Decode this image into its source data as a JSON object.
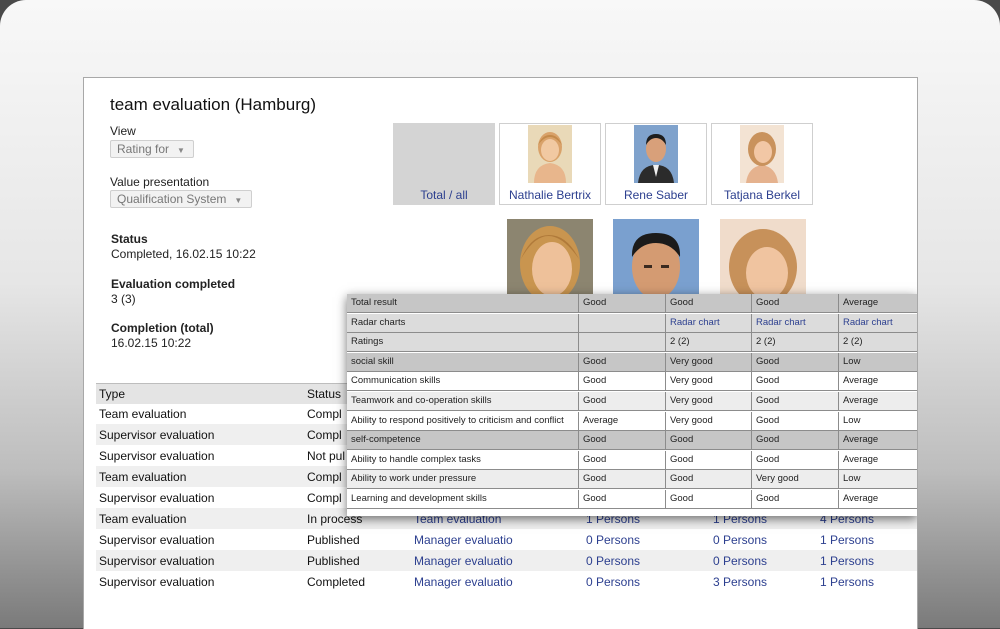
{
  "page": {
    "title": "team evaluation (Hamburg)"
  },
  "view": {
    "label": "View",
    "select_value": "Rating for"
  },
  "value_presentation": {
    "label": "Value presentation",
    "select_value": "Qualification System"
  },
  "status": {
    "label": "Status",
    "value": "Completed, 16.02.15 10:22"
  },
  "evaluation_completed": {
    "label": "Evaluation completed",
    "value": "3 (3)"
  },
  "completion_total": {
    "label": "Completion (total)",
    "value": "16.02.15 10:22"
  },
  "people": [
    {
      "name": "Total / all"
    },
    {
      "name": "Nathalie Bertrix"
    },
    {
      "name": "Rene Saber"
    },
    {
      "name": "Tatjana Berkel"
    }
  ],
  "table": {
    "headers": [
      "Type",
      "Status"
    ],
    "rows": [
      {
        "type": "Team evaluation",
        "status": "Compl",
        "form": "",
        "c1": "",
        "c2": "",
        "c3": ""
      },
      {
        "type": "Supervisor evaluation",
        "status": "Compl",
        "form": "",
        "c1": "",
        "c2": "",
        "c3": ""
      },
      {
        "type": "Supervisor evaluation",
        "status": "Not pul",
        "form": "",
        "c1": "",
        "c2": "",
        "c3": ""
      },
      {
        "type": "Team evaluation",
        "status": "Compl",
        "form": "",
        "c1": "",
        "c2": "",
        "c3": ""
      },
      {
        "type": "Supervisor evaluation",
        "status": "Compl",
        "form": "",
        "c1": "",
        "c2": "",
        "c3": ""
      },
      {
        "type": "Team evaluation",
        "status": "In process",
        "form": "Team evaluation",
        "c1": "1 Persons",
        "c2": "1 Persons",
        "c3": "4 Persons"
      },
      {
        "type": "Supervisor evaluation",
        "status": "Published",
        "form": "Manager evaluatio",
        "c1": "0 Persons",
        "c2": "0 Persons",
        "c3": "1 Persons"
      },
      {
        "type": "Supervisor evaluation",
        "status": "Published",
        "form": "Manager evaluatio",
        "c1": "0 Persons",
        "c2": "0 Persons",
        "c3": "1 Persons"
      },
      {
        "type": "Supervisor evaluation",
        "status": "Completed",
        "form": "Manager evaluatio",
        "c1": "0 Persons",
        "c2": "3 Persons",
        "c3": "1 Persons"
      }
    ]
  },
  "results": {
    "rows": [
      {
        "label": "Total result",
        "kind": "sec",
        "v": [
          "Good",
          "Good",
          "Good",
          "Average"
        ]
      },
      {
        "label": "Radar charts",
        "kind": "shade",
        "v": [
          "",
          "Radar chart",
          "Radar chart",
          "Radar chart"
        ]
      },
      {
        "label": "Ratings",
        "kind": "shade",
        "v": [
          "",
          "2 (2)",
          "2 (2)",
          "2 (2)"
        ]
      },
      {
        "label": "social skill",
        "kind": "sec",
        "v": [
          "Good",
          "Very good",
          "Good",
          "Low"
        ]
      },
      {
        "label": "Communication skills",
        "kind": "plain",
        "v": [
          "Good",
          "Very good",
          "Good",
          "Average"
        ]
      },
      {
        "label": "Teamwork and co-operation skills",
        "kind": "alt",
        "v": [
          "Good",
          "Very good",
          "Good",
          "Average"
        ]
      },
      {
        "label": "Ability to respond positively to criticism and conflict",
        "kind": "plain",
        "v": [
          "Average",
          "Very good",
          "Good",
          "Low"
        ]
      },
      {
        "label": "self-competence",
        "kind": "sec",
        "v": [
          "Good",
          "Good",
          "Good",
          "Average"
        ]
      },
      {
        "label": "Ability to handle complex tasks",
        "kind": "plain",
        "v": [
          "Good",
          "Good",
          "Good",
          "Average"
        ]
      },
      {
        "label": "Ability to work under pressure",
        "kind": "alt",
        "v": [
          "Good",
          "Good",
          "Very good",
          "Low"
        ]
      },
      {
        "label": "Learning and development skills",
        "kind": "plain",
        "v": [
          "Good",
          "Good",
          "Good",
          "Average"
        ]
      }
    ]
  },
  "colors": {
    "link": "#2c3f8f",
    "section": "#c6c6c6",
    "frame": "#e6e6e6"
  }
}
